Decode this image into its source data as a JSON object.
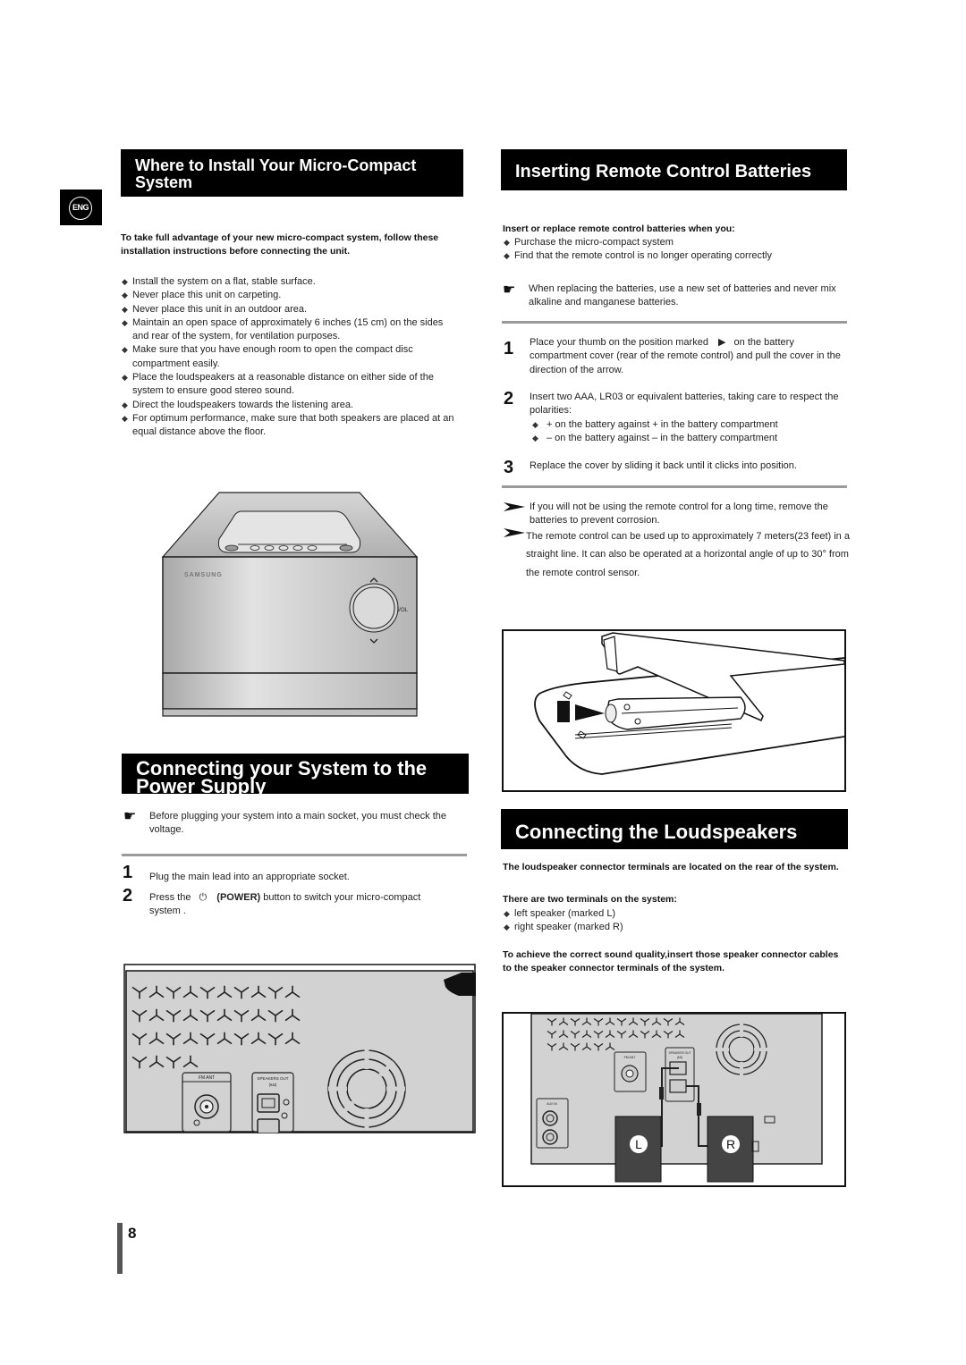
{
  "language_badge": "ENG",
  "page_number": "8",
  "install": {
    "title": "Where to Install Your Micro-Compact System",
    "intro": "To take full advantage of your new micro-compact system, follow these installation instructions before connecting the unit.",
    "bullets": [
      "Install the system on a flat, stable surface.",
      "Never place this unit on carpeting.",
      "Never place this unit in an outdoor area.",
      "Maintain an open space of approximately 6 inches (15 cm) on the sides and rear of the system, for ventilation purposes.",
      "Make sure that you have enough room to open the compact disc compartment easily.",
      "Place the loudspeakers at a reasonable distance on either side of the system to ensure good stereo sound.",
      "Direct the loudspeakers towards the listening area.",
      "For optimum performance, make sure that both speakers are placed at an equal distance above the floor."
    ],
    "figure": {
      "brand": "SAMSUNG",
      "knob_label": "VOL"
    }
  },
  "power": {
    "title": "Connecting your System to the Power Supply",
    "note": "Before plugging your system into a main socket, you must check the voltage.",
    "steps": [
      {
        "num": "1",
        "text": "Plug the main lead into an appropriate socket."
      },
      {
        "num": "2",
        "before": "Press the",
        "icon": "power-symbol",
        "bold": "(POWER)",
        "after": "button to switch your micro-compact system ."
      }
    ],
    "power_symbol": "⏻",
    "figure": {
      "fm_label": "FM ANT",
      "speakers_label": "SPEAKERS OUT",
      "ohm_label": "(6Ω)"
    }
  },
  "batteries": {
    "title": "Inserting Remote Control Batteries",
    "lead": "Insert or replace remote control batteries when you:",
    "bullets": [
      "Purchase the micro-compact system",
      "Find that the remote control is no longer operating correctly"
    ],
    "note": "When replacing the batteries, use a new set of batteries and never mix alkaline and manganese batteries.",
    "steps": [
      {
        "num": "1",
        "before": "Place your thumb on the position marked",
        "icon": "▶",
        "after": "on the battery compartment cover (rear of the remote control) and pull the cover in the direction of the arrow."
      },
      {
        "num": "2",
        "text": "Insert two AAA, LR03 or equivalent batteries, taking care to respect the polarities:",
        "sub": [
          "+ on the battery against + in the battery compartment",
          "– on the battery against – in the battery compartment"
        ]
      },
      {
        "num": "3",
        "text": "Replace the cover by sliding it back until it clicks into position."
      }
    ],
    "tips": [
      "If you will not be using the remote control for a long time, remove the batteries to prevent corrosion.",
      "The remote control can be used up to approximately 7 meters(23 feet) in  a  straight line. It can also be operated at a horizontal angle of up to 30° from the remote control sensor."
    ]
  },
  "speakers": {
    "title": "Connecting the Loudspeakers",
    "lead1": "The loudspeaker connector terminals are located on the rear of the system.",
    "lead2": "There are two terminals on the system:",
    "bullets": [
      "left speaker (marked L)",
      "right speaker (marked R)"
    ],
    "lead3": "To achieve the correct sound quality,insert those speaker connector cables to the speaker connector terminals of the system.",
    "figure": {
      "fm_label": "FM ANT",
      "speakers_label": "SPEAKERS OUT",
      "ohm_label": "(6Ω)",
      "aux_label": "AUX IN",
      "left": "L",
      "right": "R"
    }
  }
}
